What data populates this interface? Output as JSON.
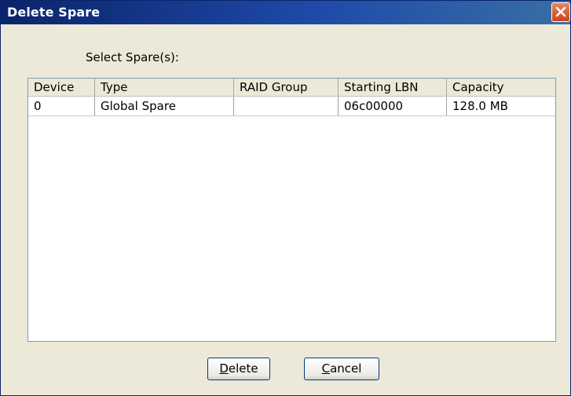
{
  "window": {
    "title": "Delete Spare"
  },
  "dialog": {
    "select_label": "Select Spare(s):"
  },
  "table": {
    "columns": [
      "Device",
      "Type",
      "RAID Group",
      "Starting LBN",
      "Capacity"
    ],
    "rows": [
      [
        "0",
        "Global Spare",
        "",
        "06c00000",
        "128.0 MB"
      ]
    ]
  },
  "buttons": {
    "delete": {
      "mnemonic": "D",
      "rest": "elete"
    },
    "cancel": {
      "mnemonic": "C",
      "rest": "ancel"
    }
  },
  "colors": {
    "title_bar": "#0a246a",
    "window_bg": "#ece9d8",
    "close_button": "#c9431f",
    "table_border": "#7f9db9"
  },
  "icons": {
    "close": "close-icon"
  }
}
